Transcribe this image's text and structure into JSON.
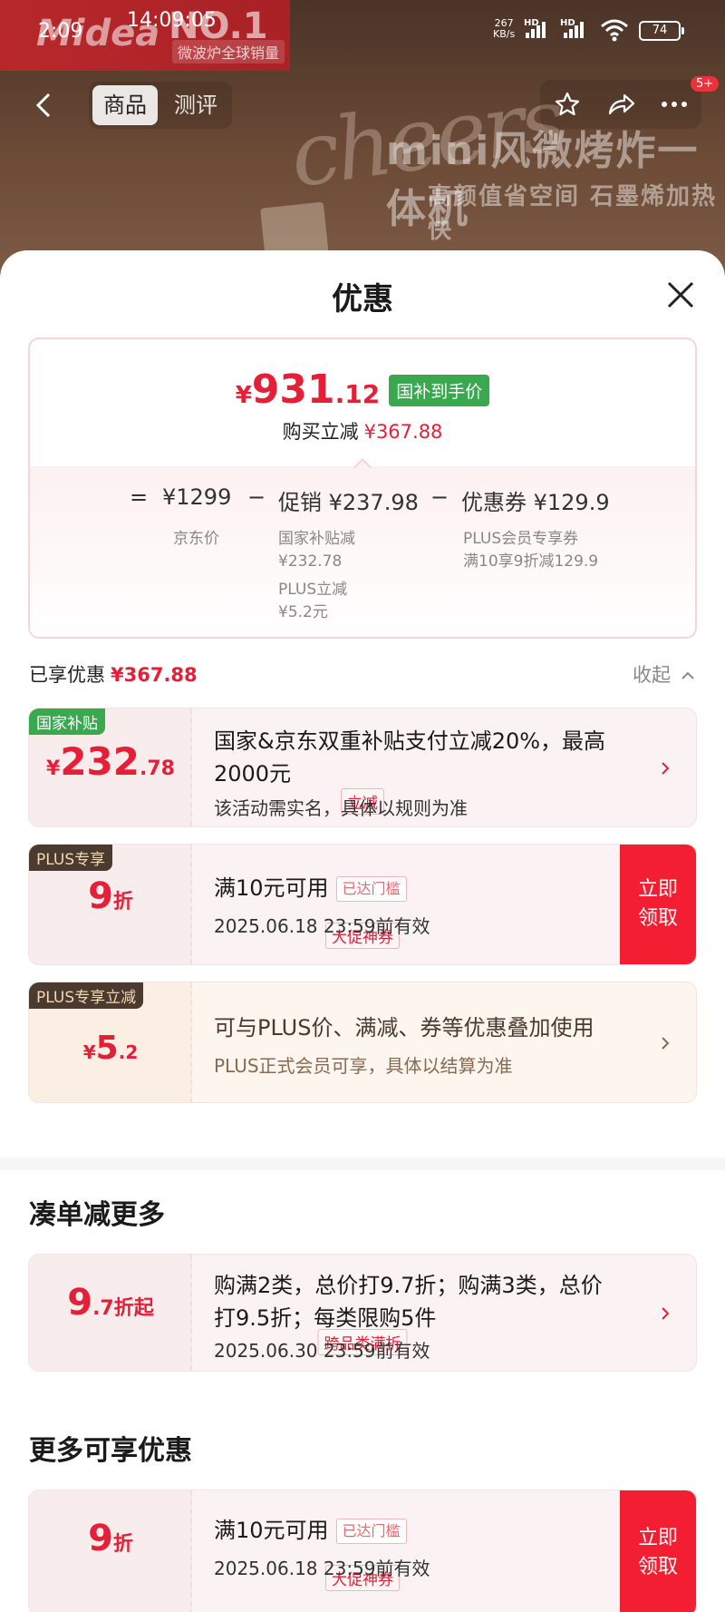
{
  "status_bar": {
    "time": "2:09",
    "clock": "14:09:05",
    "net_speed": "267",
    "net_unit": "KB/s",
    "hd1": "HD",
    "hd2": "HD",
    "battery": "74"
  },
  "hero": {
    "brand": "Midea",
    "no1": "NO.1",
    "no1_sub": "微波炉全球销量",
    "neon": "cheers",
    "headline": "mini风微烤炸一体机",
    "subline": "高颜值省空间  石墨烯加热快"
  },
  "nav": {
    "tabs": [
      "商品",
      "测评"
    ],
    "badge": "5+"
  },
  "sheet": {
    "title": "优惠"
  },
  "price_card": {
    "currency": "¥",
    "final_int": "931",
    "final_dec": ".12",
    "final_tag": "国补到手价",
    "save_label": "购买立减",
    "save_amount": "¥367.88",
    "formula": {
      "eq": "=",
      "base": "¥1299",
      "minus1": "−",
      "promo": "促销 ¥237.98",
      "minus2": "−",
      "coupon": "优惠券 ¥129.9"
    },
    "base_label": "京东价",
    "promo_items": [
      "国家补贴减",
      "¥232.78",
      "PLUS立减",
      "¥5.2元"
    ],
    "coupon_items": [
      "PLUS会员专享券",
      "满10享9折减129.9"
    ]
  },
  "enjoyed": {
    "label": "已享优惠",
    "amount": "¥367.88",
    "collapse": "收起"
  },
  "coupons": [
    {
      "tag": "国家补贴",
      "cur": "¥",
      "int": "232",
      "dec": ".78",
      "pill": "立减",
      "main1": "国家&京东双重补贴支付立减20%，最高",
      "main2": "2000元",
      "sub": "该活动需实名，具体以规则为准"
    },
    {
      "tag": "PLUS专享",
      "int": "9",
      "unit": "折",
      "pill": "大促神券",
      "main": "满10元可用",
      "met": "已达门槛",
      "sub": "2025.06.18 23:59前有效",
      "claim1": "立即",
      "claim2": "领取"
    },
    {
      "tag": "PLUS专享立减",
      "cur": "¥",
      "int": "5",
      "dec": ".2",
      "main": "可与PLUS价、满减、券等优惠叠加使用",
      "sub": "PLUS正式会员可享，具体以结算为准"
    }
  ],
  "more_section": {
    "title": "凑单减更多",
    "coupon": {
      "int": "9",
      "dec": ".7",
      "unit": "折起",
      "pill": "跨品类满折",
      "main1": "购满2类，总价打9.7折；购满3类，总价",
      "main2": "打9.5折；每类限购5件",
      "sub": "2025.06.30 23:59前有效"
    }
  },
  "extra_section": {
    "title": "更多可享优惠",
    "coupon": {
      "int": "9",
      "unit": "折",
      "pill": "大促神券",
      "main": "满10元可用",
      "met": "已达门槛",
      "sub": "2025.06.18 23:59前有效",
      "claim1": "立即",
      "claim2": "领取"
    }
  },
  "colors": {
    "accent_red": "#e51f38",
    "claim_red": "#f41e33",
    "subsidy_green": "#3aa84f",
    "plus_brown": "#4a3a30"
  }
}
